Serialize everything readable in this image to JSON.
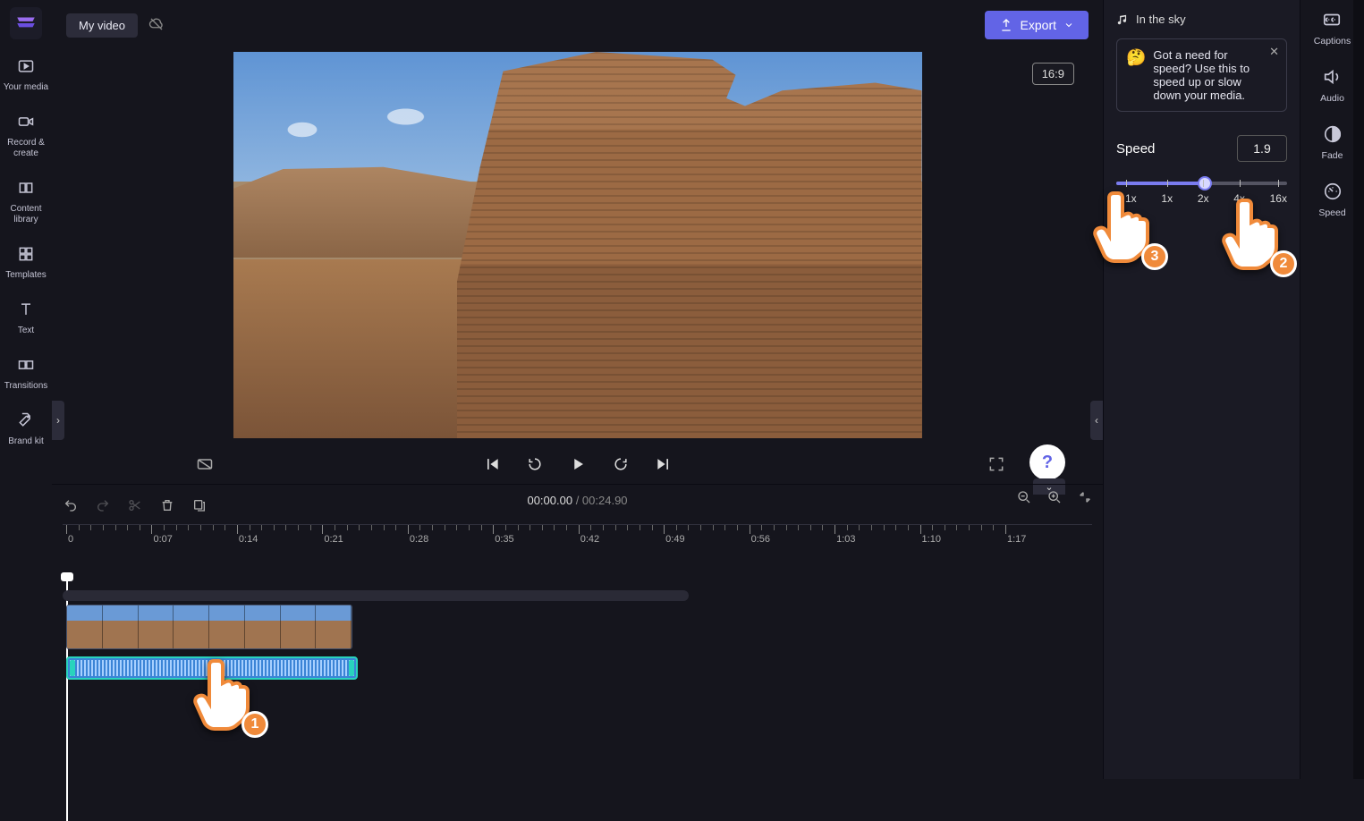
{
  "header": {
    "title": "My video",
    "export_label": "Export"
  },
  "left_rail": {
    "items": [
      {
        "label": "Your media"
      },
      {
        "label": "Record & create"
      },
      {
        "label": "Content library"
      },
      {
        "label": "Templates"
      },
      {
        "label": "Text"
      },
      {
        "label": "Transitions"
      },
      {
        "label": "Brand kit"
      }
    ]
  },
  "preview": {
    "aspect": "16:9"
  },
  "timeline": {
    "current": "00:00.00",
    "duration": "00:24.90",
    "ticks": [
      "0",
      "0:07",
      "0:14",
      "0:21",
      "0:28",
      "0:35",
      "0:42",
      "0:49",
      "0:56",
      "1:03",
      "1:10",
      "1:17"
    ]
  },
  "right_panel": {
    "track_name": "In the sky",
    "tip": "Got a need for speed? Use this to speed up or slow down your media.",
    "speed_label": "Speed",
    "speed_value": "1.9",
    "marks": [
      "0.1x",
      "1x",
      "2x",
      "4x",
      "16x"
    ]
  },
  "right_rail": {
    "items": [
      {
        "label": "Captions"
      },
      {
        "label": "Audio"
      },
      {
        "label": "Fade"
      },
      {
        "label": "Speed"
      }
    ]
  },
  "pointers": [
    "1",
    "2",
    "3"
  ]
}
